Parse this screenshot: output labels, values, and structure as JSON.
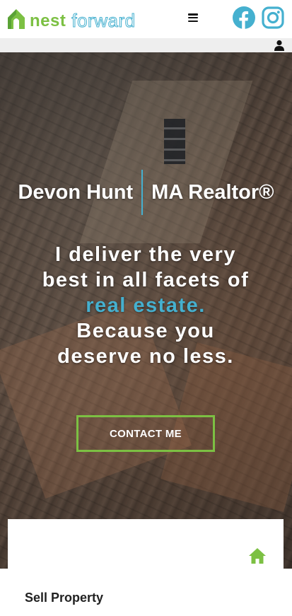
{
  "header": {
    "logo": {
      "part1": "nest",
      "part2": "forward"
    },
    "menu_icon": "hamburger-menu-icon",
    "social": [
      {
        "name": "facebook-icon",
        "color": "#45b0cf"
      },
      {
        "name": "instagram-icon",
        "color": "#45b0cf"
      }
    ]
  },
  "util_bar": {
    "user_icon": "user-icon"
  },
  "hero": {
    "name": "Devon Hunt",
    "title": "MA Realtor®",
    "tagline_part1": "I deliver the very best in all facets of",
    "tagline_accent": "real estate.",
    "tagline_part2": "Because you deserve no less.",
    "cta_label": "CONTACT ME"
  },
  "card": {
    "icon": "home-icon",
    "title": "Sell Property"
  },
  "colors": {
    "brand_green": "#7cc043",
    "brand_blue": "#45b0cf",
    "text_dark": "#222222"
  }
}
